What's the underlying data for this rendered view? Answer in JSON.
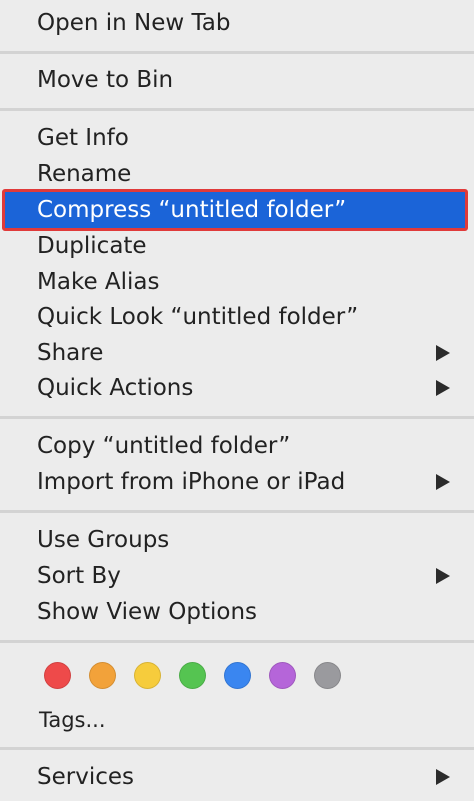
{
  "menu": {
    "items": [
      {
        "label": "Open in New Tab"
      },
      {
        "label": "Move to Bin"
      },
      {
        "label": "Get Info"
      },
      {
        "label": "Rename"
      },
      {
        "label": "Compress “untitled folder”"
      },
      {
        "label": "Duplicate"
      },
      {
        "label": "Make Alias"
      },
      {
        "label": "Quick Look “untitled folder”"
      },
      {
        "label": "Share"
      },
      {
        "label": "Quick Actions"
      },
      {
        "label": "Copy “untitled folder”"
      },
      {
        "label": "Import from iPhone or iPad"
      },
      {
        "label": "Use Groups"
      },
      {
        "label": "Sort By"
      },
      {
        "label": "Show View Options"
      },
      {
        "label": "Tags..."
      },
      {
        "label": "Services"
      }
    ],
    "highlighted_item": "Compress “untitled folder”",
    "tags": [
      {
        "name": "red-tag",
        "color": "#ee4a4a"
      },
      {
        "name": "orange-tag",
        "color": "#f2a23a"
      },
      {
        "name": "yellow-tag",
        "color": "#f6cc3c"
      },
      {
        "name": "green-tag",
        "color": "#55c451"
      },
      {
        "name": "blue-tag",
        "color": "#3a86f0"
      },
      {
        "name": "purple-tag",
        "color": "#b565d9"
      },
      {
        "name": "gray-tag",
        "color": "#9a9a9e"
      }
    ],
    "colors": {
      "background": "#ececec",
      "highlight": "#1b64d8",
      "highlight_border": "#e03a3a",
      "separator": "#d3d3d3",
      "text": "#222222"
    }
  }
}
